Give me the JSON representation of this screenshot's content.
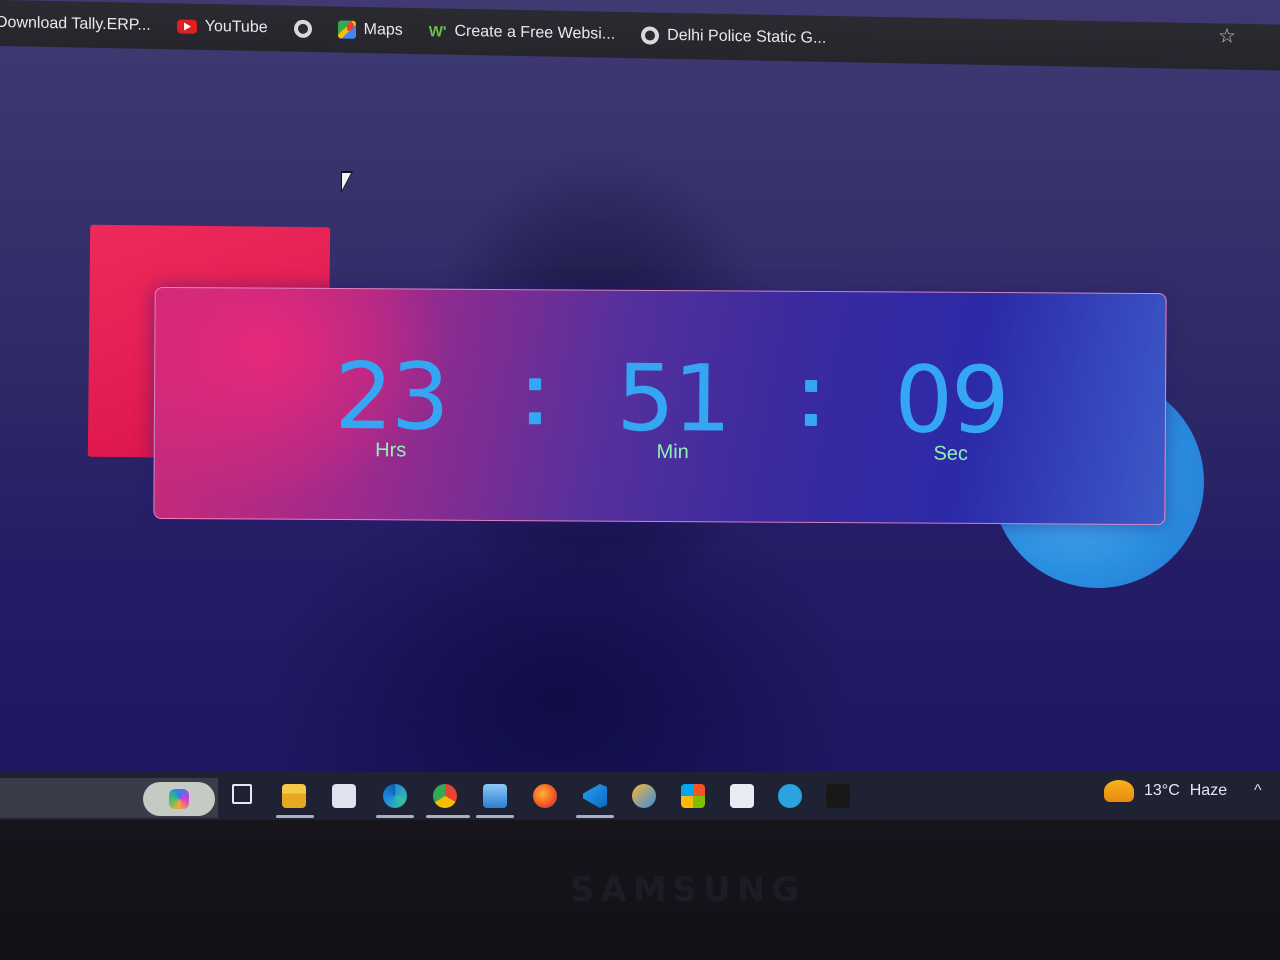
{
  "bookmarks": [
    {
      "label": "Download Tally.ERP...",
      "icon": "none"
    },
    {
      "label": "YouTube",
      "icon": "youtube-icon"
    },
    {
      "label": "",
      "icon": "globe-icon"
    },
    {
      "label": "Maps",
      "icon": "maps-icon"
    },
    {
      "label": "Create a Free Websi...",
      "icon": "wix-icon"
    },
    {
      "label": "Delhi Police Static G...",
      "icon": "globe-icon"
    }
  ],
  "clock": {
    "hours": "23",
    "minutes": "51",
    "seconds": "09",
    "hours_label": "Hrs",
    "minutes_label": "Min",
    "seconds_label": "Sec",
    "separator": ":"
  },
  "taskbar": {
    "apps": [
      "copilot",
      "task-view",
      "file-explorer",
      "store",
      "edge",
      "chrome",
      "mail",
      "firefox",
      "vscode",
      "cube-app",
      "windows-app",
      "doc-app",
      "telegram",
      "adobe-app"
    ],
    "weather_temp": "13°C",
    "weather_condition": "Haze"
  },
  "bezel": {
    "brand": "SAMSUNG"
  },
  "colors": {
    "clock_digits": "#35a6f3",
    "clock_labels": "#8ff0b4",
    "pink_square": "#e61f55",
    "blue_circle": "#3a9ce8"
  }
}
